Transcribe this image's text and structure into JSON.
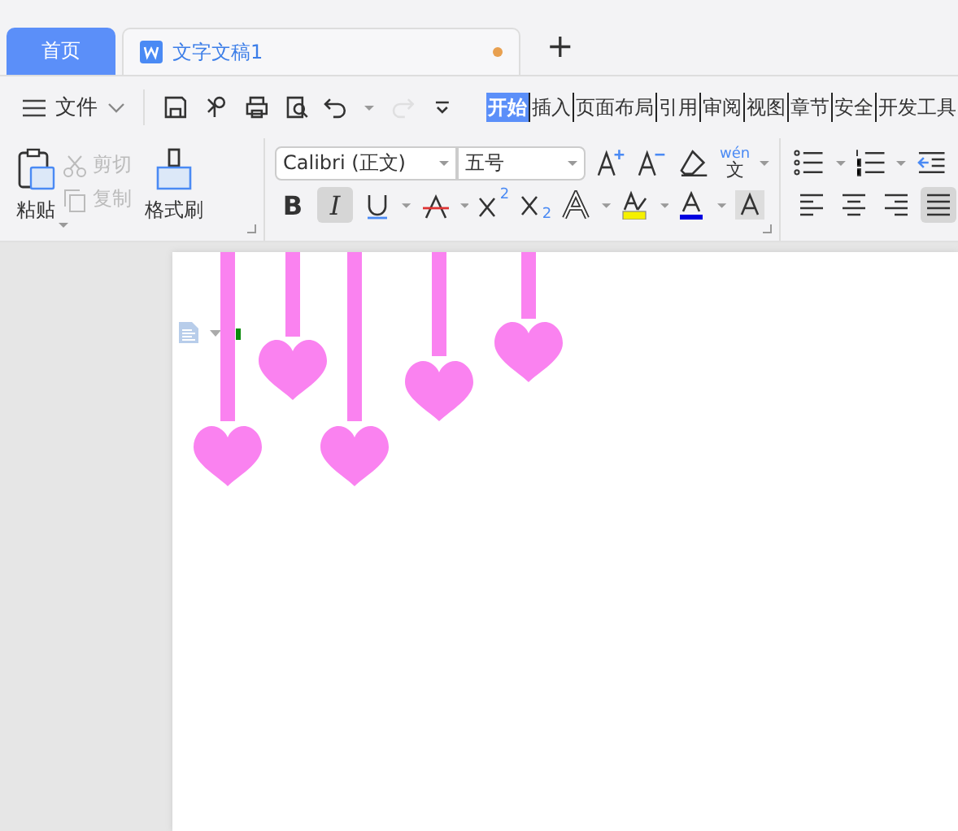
{
  "tabs": [
    {
      "label": "首页",
      "kind": "home",
      "selected": false
    },
    {
      "label": "文字文稿1",
      "kind": "document",
      "selected": true,
      "unsaved": true
    }
  ],
  "new_tab": "+",
  "file_menu": {
    "label": "文件"
  },
  "quick_tools": [
    {
      "kind": "save",
      "disabled": false
    },
    {
      "kind": "clip",
      "disabled": false
    },
    {
      "kind": "print",
      "disabled": false
    },
    {
      "kind": "preview",
      "disabled": false
    },
    {
      "kind": "undo",
      "disabled": false
    },
    {
      "kind": "redo",
      "disabled": true
    },
    {
      "kind": "more",
      "disabled": false
    }
  ],
  "menu_tabs": [
    {
      "label": "开始",
      "selected": true
    },
    {
      "label": "插入",
      "selected": false
    },
    {
      "label": "页面布局",
      "selected": false
    },
    {
      "label": "引用",
      "selected": false
    },
    {
      "label": "审阅",
      "selected": false
    },
    {
      "label": "视图",
      "selected": false
    },
    {
      "label": "章节",
      "selected": false
    },
    {
      "label": "安全",
      "selected": false
    },
    {
      "label": "开发工具",
      "selected": false
    }
  ],
  "clipboard": {
    "paste": "粘贴",
    "cut": {
      "label": "剪切",
      "disabled": true
    },
    "copy": {
      "label": "复制",
      "disabled": true
    },
    "format_painter": "格式刷"
  },
  "font": {
    "name": "Calibri (正文)",
    "size": "五号",
    "row1": [
      {
        "kind": "grow"
      },
      {
        "kind": "shrink"
      },
      {
        "kind": "clear"
      },
      {
        "kind": "pinyin",
        "label": "wén",
        "sub": "文"
      }
    ],
    "row2": [
      {
        "kind": "bold",
        "label": "B",
        "selected": false
      },
      {
        "kind": "italic",
        "label": "I",
        "selected": true
      },
      {
        "kind": "underline",
        "selected": false
      },
      {
        "kind": "strike",
        "selected": false
      },
      {
        "kind": "superscript",
        "label": "2",
        "selected": false
      },
      {
        "kind": "subscript",
        "label": "2",
        "selected": false
      },
      {
        "kind": "outline",
        "selected": false
      },
      {
        "kind": "highlight",
        "selected": false
      },
      {
        "kind": "fontcolor",
        "selected": false
      },
      {
        "kind": "shading",
        "selected": false
      }
    ]
  },
  "paragraph": {
    "row1": [
      {
        "kind": "bullets"
      },
      {
        "kind": "numbering"
      },
      {
        "kind": "outdent"
      }
    ],
    "row2": [
      {
        "kind": "left",
        "selected": false
      },
      {
        "kind": "center",
        "selected": false
      },
      {
        "kind": "right",
        "selected": false
      },
      {
        "kind": "justify",
        "selected": true
      }
    ]
  }
}
